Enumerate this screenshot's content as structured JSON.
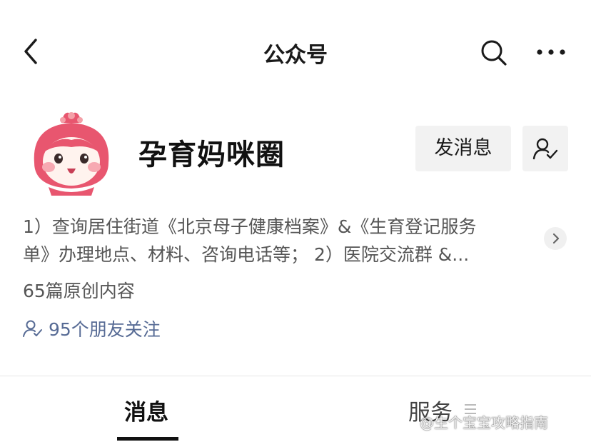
{
  "header": {
    "title": "公众号",
    "back_icon": "chevron-left-icon",
    "search_icon": "search-icon",
    "more_icon": "more-horizontal-icon"
  },
  "account": {
    "name": "孕育妈咪圈",
    "avatar": "cartoon-strawberry-girl-avatar",
    "send_message_label": "发消息",
    "follow_icon": "user-check-icon",
    "description_line1": "1）查询居住街道《北京母子健康档案》&《生育登记服务",
    "description_line2": "单》办理地点、材料、咨询电话等； 2）医院交流群 &...",
    "original_content": "65篇原创内容",
    "friends_following": "95个朋友关注"
  },
  "tabs": [
    {
      "label": "消息",
      "active": true
    },
    {
      "label": "服务",
      "active": false
    }
  ],
  "watermark": "@生个宝宝攻略指南",
  "colors": {
    "link": "#576b95",
    "button_bg": "#f2f2f2",
    "avatar_pink": "#e8566f"
  }
}
